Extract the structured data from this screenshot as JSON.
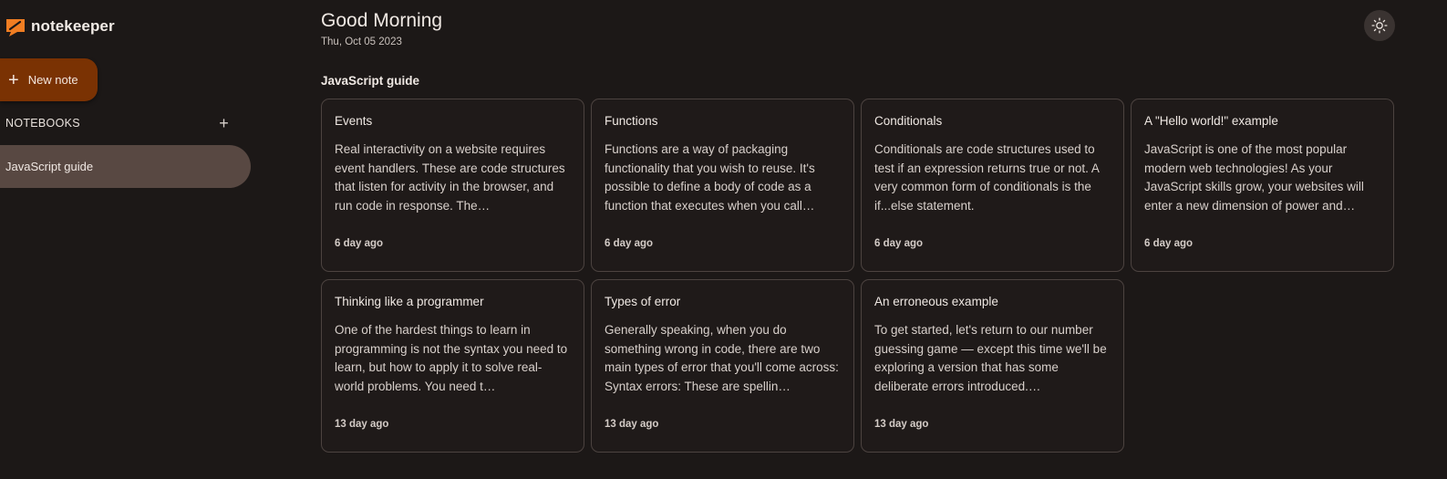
{
  "app": {
    "name": "notekeeper",
    "accent_color": "#7a3203",
    "logo_color": "#f07d22",
    "logo_icon": "logo-icon"
  },
  "sidebar": {
    "new_note_label": "New note",
    "new_note_icon": "plus-icon",
    "notebooks_heading": "NOTEBOOKS",
    "add_notebook_icon": "plus-icon",
    "notebooks": [
      {
        "label": "JavaScript guide",
        "active": true
      }
    ]
  },
  "header": {
    "greeting": "Good Morning",
    "date": "Thu, Oct 05 2023",
    "theme_toggle_icon": "sun-icon"
  },
  "main": {
    "section_title": "JavaScript guide",
    "notes": [
      {
        "title": "Events",
        "body": "Real interactivity on a website requires event handlers. These are code structures that listen for activity in the browser, and run code in response. The…",
        "time": "6 day ago"
      },
      {
        "title": "Functions",
        "body": "Functions are a way of packaging functionality that you wish to reuse. It's possible to define a body of code as a function that executes when you call…",
        "time": "6 day ago"
      },
      {
        "title": "Conditionals",
        "body": "Conditionals are code structures used to test if an expression returns true or not. A very common form of conditionals is the if...else statement.",
        "time": "6 day ago"
      },
      {
        "title": "A \"Hello world!\" example",
        "body": "JavaScript is one of the most popular modern web technologies! As your JavaScript skills grow, your websites will enter a new dimension of power and…",
        "time": "6 day ago"
      },
      {
        "title": "Thinking like a programmer",
        "body": "One of the hardest things to learn in programming is not the syntax you need to learn, but how to apply it to solve real-world problems. You need t…",
        "time": "13 day ago"
      },
      {
        "title": "Types of error",
        "body": "Generally speaking, when you do something wrong in code, there are two main types of error that you'll come across: Syntax errors: These are spellin…",
        "time": "13 day ago"
      },
      {
        "title": "An erroneous example",
        "body": "To get started, let's return to our number guessing game — except this time we'll be exploring a version that has some deliberate errors introduced.…",
        "time": "13 day ago"
      }
    ]
  }
}
